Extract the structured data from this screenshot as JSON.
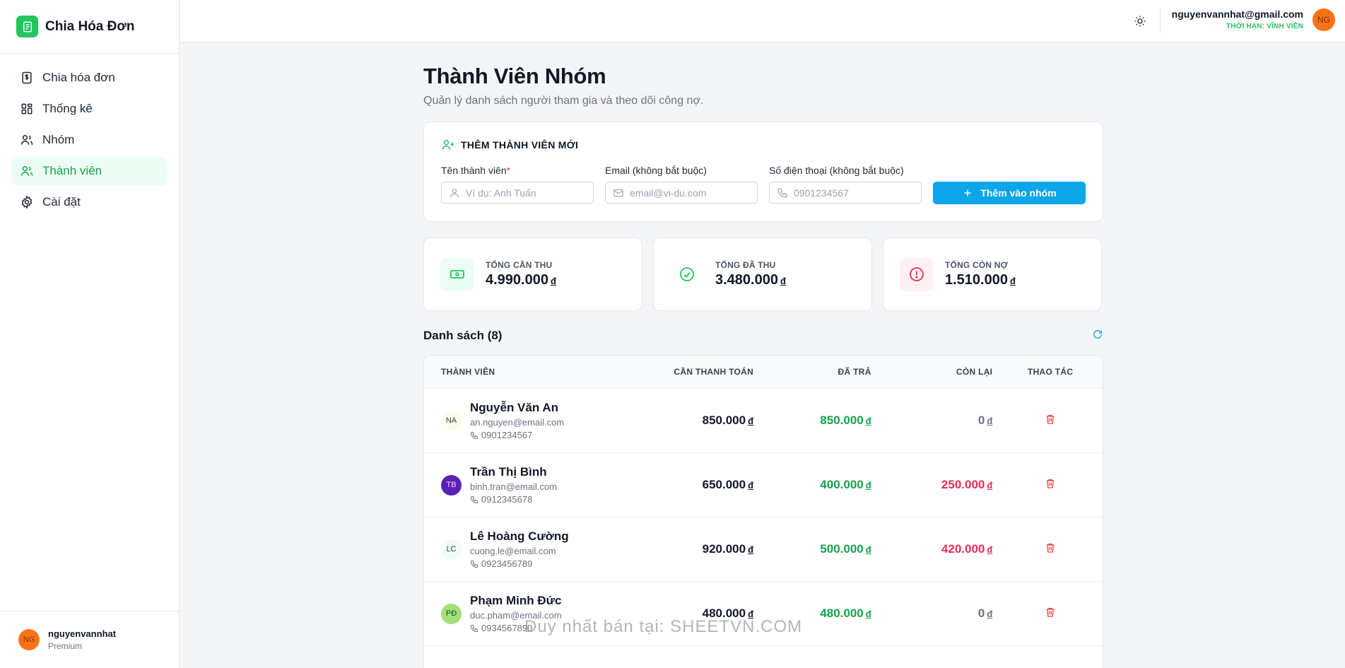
{
  "brand": {
    "name": "Chia Hóa Đơn"
  },
  "sidebar": {
    "items": [
      {
        "label": "Chia hóa đơn",
        "icon": "dollar-receipt-icon"
      },
      {
        "label": "Thống kê",
        "icon": "dashboard-grid-icon"
      },
      {
        "label": "Nhóm",
        "icon": "group-icon"
      },
      {
        "label": "Thành viên",
        "icon": "users-icon",
        "active": true
      },
      {
        "label": "Cài đặt",
        "icon": "gear-icon"
      }
    ],
    "user": {
      "initials": "NG",
      "name": "nguyenvannhat",
      "plan": "Premium"
    }
  },
  "topbar": {
    "email": "nguyenvannhat@gmail.com",
    "plan": "THỜI HẠN: VĨNH VIỄN",
    "initials": "NG"
  },
  "page": {
    "title": "Thành Viên Nhóm",
    "subtitle": "Quản lý danh sách người tham gia và theo dõi công nợ."
  },
  "add_form": {
    "heading": "THÊM THÀNH VIÊN MỚI",
    "name_label": "Tên thành viên",
    "required_mark": "*",
    "name_placeholder": "Ví dụ: Anh Tuấn",
    "email_label": "Email (không bắt buộc)",
    "email_placeholder": "email@vi-du.com",
    "phone_label": "Số điện thoại (không bắt buộc)",
    "phone_placeholder": "0901234567",
    "submit_label": "Thêm vào nhóm"
  },
  "stats": [
    {
      "label": "TỔNG CẦN THU",
      "value": "4.990.000",
      "currency": "đ"
    },
    {
      "label": "TỔNG ĐÃ THU",
      "value": "3.480.000",
      "currency": "đ"
    },
    {
      "label": "TỔNG CÒN NỢ",
      "value": "1.510.000",
      "currency": "đ"
    }
  ],
  "list": {
    "title": "Danh sách (8)",
    "columns": [
      "THÀNH VIÊN",
      "CẦN THANH TOÁN",
      "ĐÃ TRẢ",
      "CÒN LẠI",
      "THAO TÁC"
    ],
    "currency": "đ",
    "rows": [
      {
        "initials": "NA",
        "name": "Nguyễn Văn An",
        "email": "an.nguyen@email.com",
        "phone": "0901234567",
        "due": "850.000",
        "paid": "850.000",
        "remaining": "0"
      },
      {
        "initials": "TB",
        "name": "Trần Thị Bình",
        "email": "binh.tran@email.com",
        "phone": "0912345678",
        "due": "650.000",
        "paid": "400.000",
        "remaining": "250.000"
      },
      {
        "initials": "LC",
        "name": "Lê Hoàng Cường",
        "email": "cuong.le@email.com",
        "phone": "0923456789",
        "due": "920.000",
        "paid": "500.000",
        "remaining": "420.000"
      },
      {
        "initials": "PĐ",
        "name": "Phạm Minh Đức",
        "email": "duc.pham@email.com",
        "phone": "0934567890",
        "due": "480.000",
        "paid": "480.000",
        "remaining": "0"
      }
    ]
  },
  "watermark": "Duy nhất bán tại: SHEETVN.COM",
  "colors": {
    "accent_green": "#22c55e",
    "primary_blue": "#0ea5e9",
    "debt_red": "#ef2b55",
    "avatar_orange": "#f97316"
  }
}
